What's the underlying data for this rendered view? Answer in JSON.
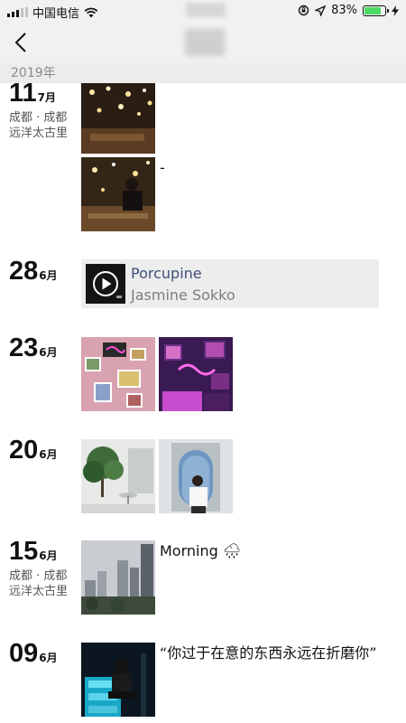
{
  "status_bar": {
    "carrier": "中国电信",
    "battery": "83%",
    "battery_level": 0.83
  },
  "nav": {
    "back_icon": "chevron-left-icon"
  },
  "year_header": "2019年",
  "entries": [
    {
      "day": "11",
      "month": "7月",
      "location_line1": "成都 · 成都",
      "location_line2": "远洋太古里",
      "caption": "-"
    },
    {
      "day": "28",
      "month": "6月",
      "music": {
        "title": "Porcupine",
        "artist": "Jasmine Sokko"
      }
    },
    {
      "day": "23",
      "month": "6月"
    },
    {
      "day": "20",
      "month": "6月"
    },
    {
      "day": "15",
      "month": "6月",
      "location_line1": "成都 · 成都",
      "location_line2": "远洋太古里",
      "caption": "Morning 🌧"
    },
    {
      "day": "09",
      "month": "6月",
      "caption": "“你过于在意的东西永远在折磨你”"
    }
  ]
}
